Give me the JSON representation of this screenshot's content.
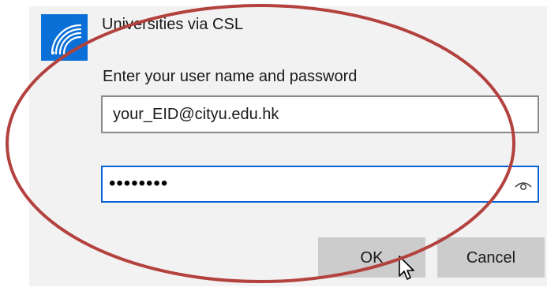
{
  "dialog": {
    "icon": "wifi-icon",
    "accent_color": "#0a6fd6",
    "network_name": "Universities via CSL",
    "prompt": "Enter your user name and password",
    "username_value": "your_EID@cityu.edu.hk",
    "password_masked": "••••••••",
    "reveal_icon": "eye-icon",
    "ok_label": "OK",
    "cancel_label": "Cancel"
  },
  "annotation": {
    "shape": "ellipse",
    "color": "#b3423f"
  }
}
